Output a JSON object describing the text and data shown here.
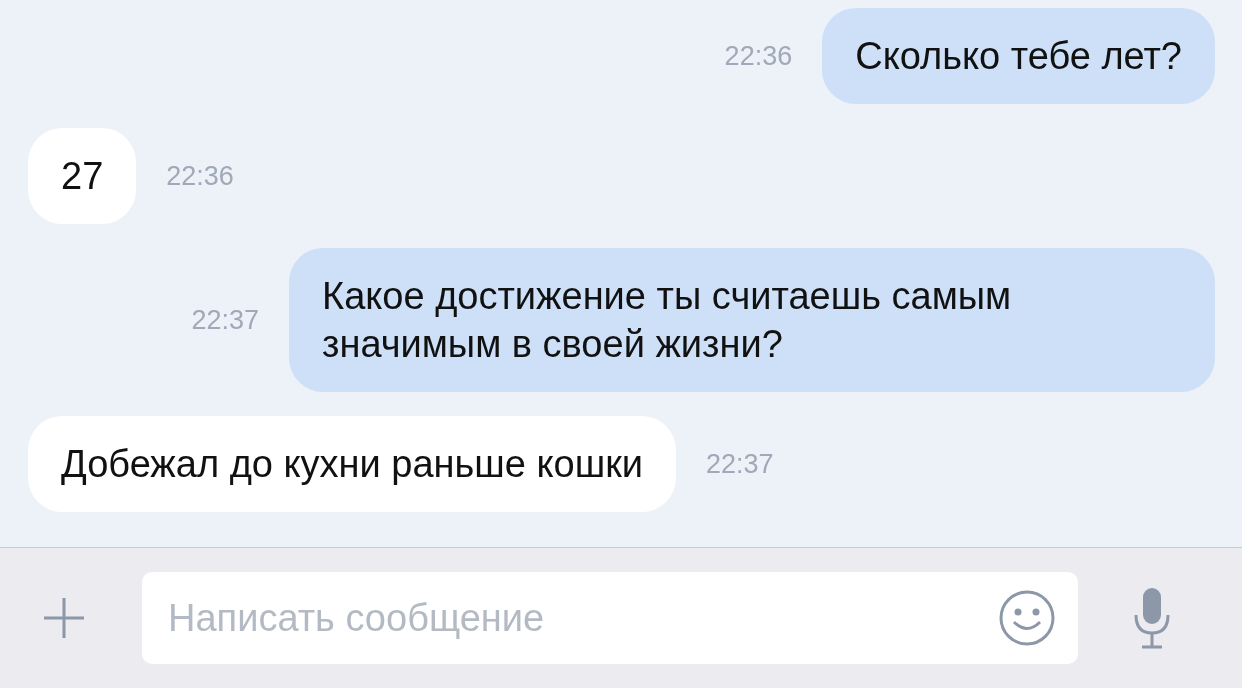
{
  "messages": [
    {
      "kind": "outgoing",
      "text": "Сколько тебе лет?",
      "time": "22:36"
    },
    {
      "kind": "incoming",
      "text": "27",
      "time": "22:36"
    },
    {
      "kind": "outgoing",
      "text": "Какое достижение ты считаешь самым значимым в своей жизни?",
      "time": "22:37"
    },
    {
      "kind": "incoming",
      "text": "Добежал до кухни раньше кошки",
      "time": "22:37"
    }
  ],
  "composer": {
    "placeholder": "Написать сообщение"
  }
}
